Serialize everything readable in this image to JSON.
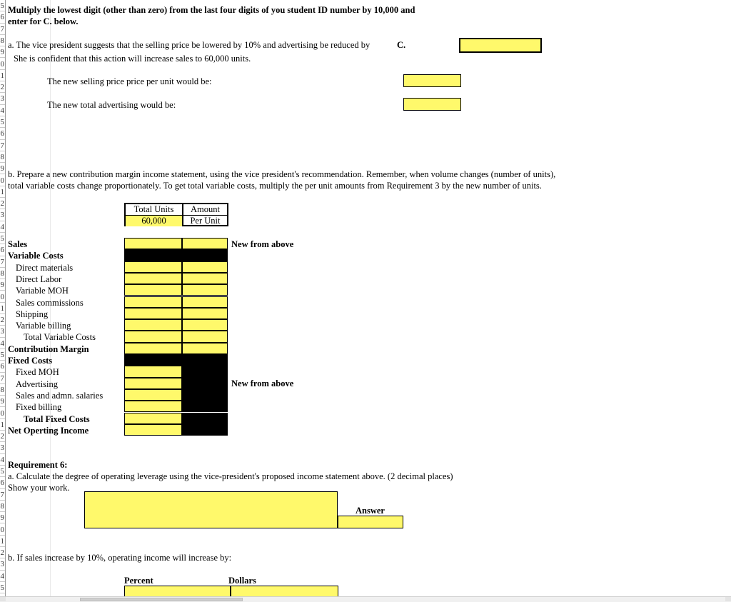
{
  "sheet": {
    "row_numbers": [
      "5",
      "6",
      "7",
      "8",
      "9",
      "0",
      "1",
      "2",
      "3",
      "4",
      "5",
      "6",
      "7",
      "8",
      "9",
      "0",
      "1",
      "2",
      "3",
      "4",
      "5",
      "6",
      "7",
      "8",
      "9",
      "0",
      "1",
      "2",
      "3",
      "4",
      "5",
      "6",
      "7",
      "8",
      "9",
      "0",
      "1",
      "2",
      "3",
      "4",
      "5",
      "6",
      "7",
      "8",
      "9",
      "0",
      "1",
      "2",
      "3",
      "4",
      "5"
    ]
  },
  "instructions": {
    "line1": "Multiply the lowest digit (other than zero) from the last four digits of you student ID number by 10,000 and",
    "line2": "enter  for C. below."
  },
  "part_a": {
    "line1": "a.  The vice president suggests that the selling price be lowered by 10%  and advertising be reduced by",
    "line2": "She is confident that this action will increase sales to 60,000 units.",
    "c_label": "C.",
    "c_value": "",
    "new_price_label": "The new selling price price per unit  would be:",
    "new_price_value": "",
    "new_advertising_label": "The new total advertising would be:",
    "new_advertising_value": ""
  },
  "part_b": {
    "line1": "b.  Prepare a new contribution margin income statement, using the vice president's recommendation.  Remember, when volume changes (number of units),",
    "line2": "total variable costs change proportionately.  To get total variable costs, multiply the per unit amounts from Requirement 3 by the new number of units."
  },
  "units_table": {
    "header_left": "Total Units",
    "header_right": "Amount",
    "value_left": "60,000",
    "value_right": "Per Unit"
  },
  "income_statement": {
    "note_sales": "New from above",
    "note_fixed": "New from above",
    "rows": [
      {
        "label": "Sales",
        "indent": 0,
        "bold": true,
        "style": "two-yellow"
      },
      {
        "label": "Variable Costs",
        "indent": 0,
        "bold": true,
        "style": "two-black"
      },
      {
        "label": "Direct materials",
        "indent": 1,
        "bold": false,
        "style": "two-yellow"
      },
      {
        "label": "Direct Labor",
        "indent": 1,
        "bold": false,
        "style": "two-yellow"
      },
      {
        "label": "Variable MOH",
        "indent": 1,
        "bold": false,
        "style": "two-yellow"
      },
      {
        "label": "Sales commissions",
        "indent": 1,
        "bold": false,
        "style": "two-yellow"
      },
      {
        "label": "Shipping",
        "indent": 1,
        "bold": false,
        "style": "two-yellow"
      },
      {
        "label": "Variable billing",
        "indent": 1,
        "bold": false,
        "style": "two-yellow"
      },
      {
        "label": "Total Variable Costs",
        "indent": 2,
        "bold": false,
        "style": "two-yellow"
      },
      {
        "label": "Contribution Margin",
        "indent": 0,
        "bold": true,
        "style": "two-yellow"
      },
      {
        "label": "Fixed Costs",
        "indent": 0,
        "bold": true,
        "style": "two-black"
      },
      {
        "label": "Fixed MOH",
        "indent": 1,
        "bold": false,
        "style": "left-yellow"
      },
      {
        "label": "Advertising",
        "indent": 1,
        "bold": false,
        "style": "left-yellow"
      },
      {
        "label": "Sales and admn. salaries",
        "indent": 1,
        "bold": false,
        "style": "left-yellow"
      },
      {
        "label": "Fixed billing",
        "indent": 1,
        "bold": false,
        "style": "left-yellow"
      },
      {
        "label": "Total Fixed Costs",
        "indent": 2,
        "bold": true,
        "style": "left-yellow"
      },
      {
        "label": "Net Operting Income",
        "indent": 0,
        "bold": true,
        "style": "left-yellow"
      }
    ]
  },
  "requirement6": {
    "title": "Requirement 6:",
    "line_a": "a.  Calculate the degree of operating leverage using the vice-president's proposed income statement above. (2 decimal places)",
    "line_show": "Show your work.",
    "work_value": "",
    "answer_label": "Answer",
    "answer_value": "",
    "line_b": "b.  If sales increase by 10%, operating income will increase by:",
    "percent_label": "Percent",
    "dollars_label": "Dollars",
    "percent_value": "",
    "dollars_value": ""
  },
  "colors": {
    "input_fill": "#FFF96B",
    "blocked_fill": "#000000",
    "border": "#000000"
  }
}
